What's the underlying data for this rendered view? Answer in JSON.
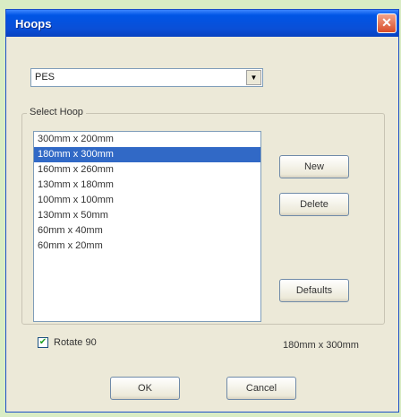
{
  "window": {
    "title": "Hoops",
    "close_glyph": "✕"
  },
  "format_combo": {
    "value": "PES",
    "arrow_glyph": "▼"
  },
  "group": {
    "label": "Select Hoop"
  },
  "hoops": {
    "items": [
      "300mm x 200mm",
      "180mm x 300mm",
      "160mm x 260mm",
      "130mm x 180mm",
      "100mm x 100mm",
      "130mm x 50mm",
      "60mm x 40mm",
      "60mm x 20mm"
    ],
    "selected_index": 1
  },
  "buttons": {
    "new": "New",
    "delete": "Delete",
    "defaults": "Defaults",
    "ok": "OK",
    "cancel": "Cancel"
  },
  "rotate": {
    "label": "Rotate 90",
    "checked": true,
    "check_glyph": "✔"
  },
  "size_readout": "180mm x 300mm"
}
